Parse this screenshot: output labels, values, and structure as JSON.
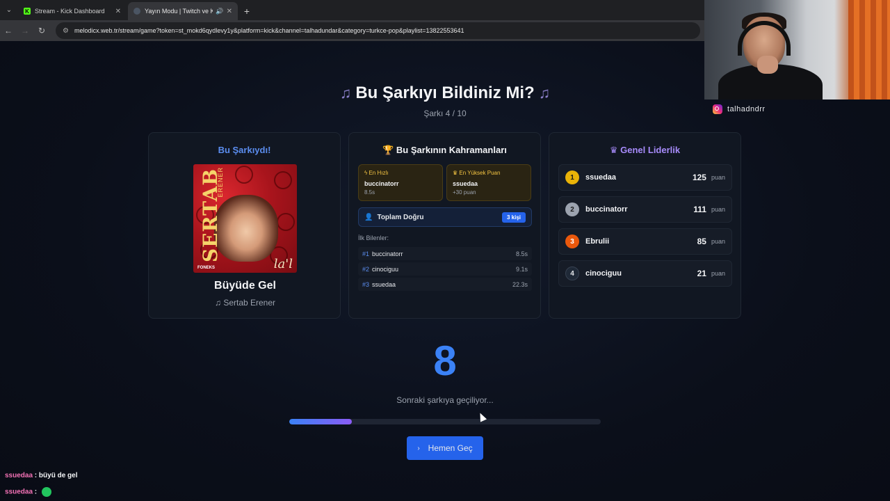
{
  "browser": {
    "tabs": [
      {
        "title": "Stream - Kick Dashboard",
        "active": false
      },
      {
        "title": "Yayın Modu | Twitch ve Kick",
        "active": true
      }
    ],
    "url": "melodicx.web.tr/stream/game?token=st_mokd6qydlevy1y&platform=kick&channel=talhadundar&category=turkce-pop&playlist=13822553641"
  },
  "header": {
    "title": "Bu Şarkıyı Bildiniz Mi?",
    "progress_text": "Şarkı 4 / 10"
  },
  "song_card": {
    "heading": "Bu Şarkıydı!",
    "song_title": "Büyüde Gel",
    "artist": "Sertab Erener",
    "cover_text": {
      "artist": "SERTAB",
      "artist2": "ERENER",
      "label": "FONEKS",
      "signature": "la'l"
    }
  },
  "heroes_card": {
    "heading": "Bu Şarkının Kahramanları",
    "fastest": {
      "label": "En Hızlı",
      "user": "buccinatorr",
      "value": "8.5s"
    },
    "highest": {
      "label": "En Yüksek Puan",
      "user": "ssuedaa",
      "value": "+30 puan"
    },
    "total": {
      "label": "Toplam Doğru",
      "count": "3 kişi"
    },
    "first_label": "İlk Bilenler:",
    "first": [
      {
        "rank": "#1",
        "user": "buccinatorr",
        "time": "8.5s"
      },
      {
        "rank": "#2",
        "user": "cinociguu",
        "time": "9.1s"
      },
      {
        "rank": "#3",
        "user": "ssuedaa",
        "time": "22.3s"
      }
    ]
  },
  "leaderboard": {
    "heading": "Genel Liderlik",
    "unit": "puan",
    "rows": [
      {
        "rank": "1",
        "user": "ssuedaa",
        "points": "125",
        "color": "#eab308",
        "text": "#1a1a1a"
      },
      {
        "rank": "2",
        "user": "buccinatorr",
        "points": "111",
        "color": "#9ca3af",
        "text": "#1a1a1a"
      },
      {
        "rank": "3",
        "user": "Ebrulii",
        "points": "85",
        "color": "#ea580c",
        "text": "#ffffff"
      },
      {
        "rank": "4",
        "user": "cinociguu",
        "points": "21",
        "color": "#1f2937",
        "text": "#e5e7eb"
      }
    ]
  },
  "countdown": {
    "value": "8",
    "text": "Sonraki şarkıya geçiliyor...",
    "progress": 0.2,
    "skip_label": "Hemen Geç"
  },
  "chat": [
    {
      "user": "ssuedaa",
      "message": "büyü de gel",
      "emote": false
    },
    {
      "user": "ssuedaa",
      "message": "",
      "emote": true
    }
  ],
  "overlay": {
    "handle": "talhadndrr"
  },
  "colors": {
    "accent": "#3b82f6",
    "purple": "#8b5cf6",
    "gold": "#f5c542"
  }
}
